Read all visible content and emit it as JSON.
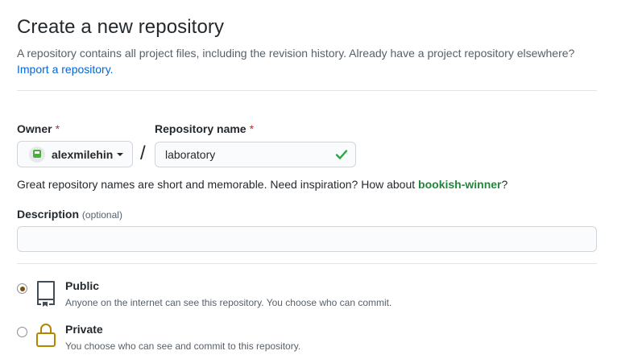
{
  "header": {
    "title": "Create a new repository",
    "subtitle": "A repository contains all project files, including the revision history. Already have a project repository elsewhere?",
    "import_link": "Import a repository."
  },
  "owner": {
    "label": "Owner",
    "required_mark": "*",
    "value": "alexmilehin"
  },
  "separator": "/",
  "repository_name": {
    "label": "Repository name",
    "required_mark": "*",
    "value": "laboratory",
    "valid": true
  },
  "name_hint": {
    "text": "Great repository names are short and memorable. Need inspiration? How about",
    "suggestion": "bookish-winner",
    "suffix": "?"
  },
  "description": {
    "label": "Description",
    "optional": "(optional)",
    "value": ""
  },
  "visibility": {
    "selected": "public",
    "options": [
      {
        "id": "public",
        "title": "Public",
        "description": "Anyone on the internet can see this repository. You choose who can commit."
      },
      {
        "id": "private",
        "title": "Private",
        "description": "You choose who can see and commit to this repository."
      }
    ]
  },
  "colors": {
    "link": "#0366d6",
    "success": "#28a745",
    "suggestion": "#22863a",
    "required": "#cb2431",
    "private_icon": "#b08800"
  },
  "icons": {
    "owner_avatar": "identicon-avatar",
    "owner_caret": "caret-down-icon",
    "name_valid": "check-icon",
    "public": "repo-icon",
    "private": "lock-icon"
  }
}
